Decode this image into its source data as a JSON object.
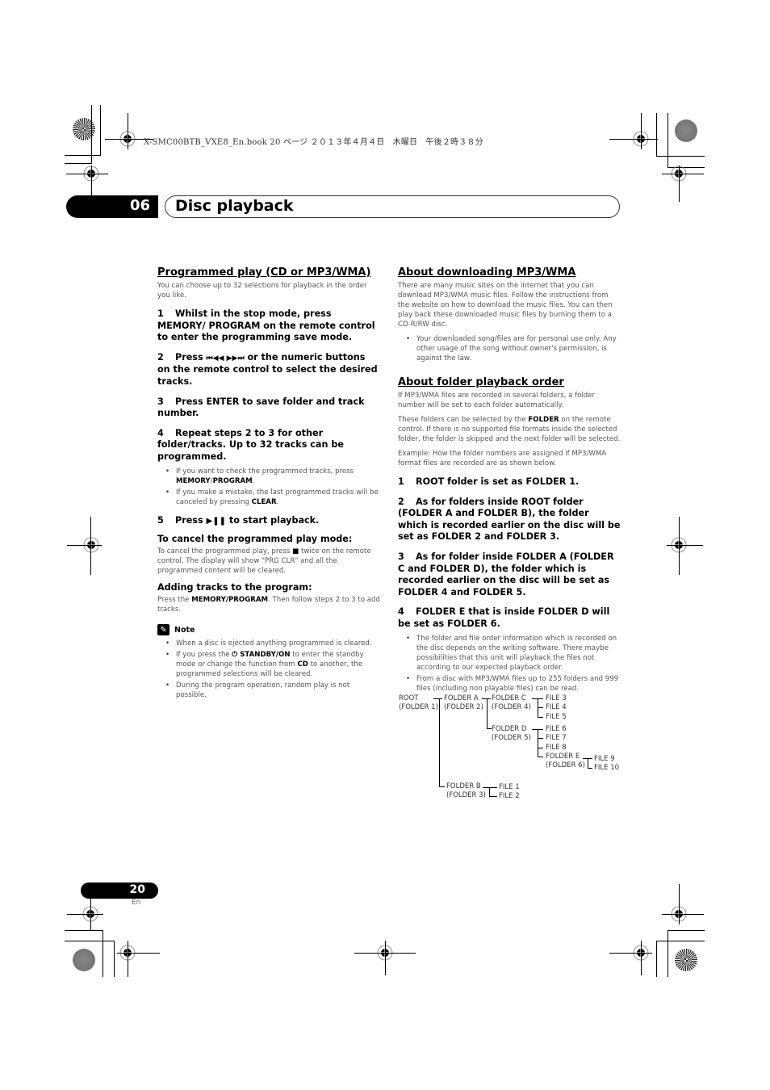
{
  "print_header": {
    "meta_text": "X-SMC00BTB_VXE8_En.book  20 ページ  ２０１３年４月４日　木曜日　午後２時３８分"
  },
  "chapter": {
    "number": "06",
    "title": "Disc playback"
  },
  "left_column": {
    "section_title": "Programmed play (CD or MP3/WMA)",
    "intro": "You can choose up to 32 selections for playback in the order you like.",
    "steps": [
      {
        "num": "1",
        "text": "Whilst in the stop mode, press MEMORY/ PROGRAM on the remote control to enter the programming save mode."
      },
      {
        "num": "2",
        "text_before": "Press ",
        "icons": "⏮◀◀ ▶▶⏭",
        "text_after": " or the numeric buttons on the remote control to select the desired tracks."
      },
      {
        "num": "3",
        "text": "Press ENTER to save folder and track number."
      },
      {
        "num": "4",
        "text": "Repeat steps 2 to 3 for other folder/tracks. Up to 32 tracks can be programmed."
      },
      {
        "num": "5",
        "text_before": "Press ",
        "icons": "▶❚❚",
        "text_after": " to start playback."
      }
    ],
    "step4_bullets": [
      {
        "before": "If you want to check the programmed tracks, press ",
        "bold": "MEMORY",
        "mid": "/",
        "bold2": "PROGRAM",
        "after": "."
      },
      {
        "before": "If you make a mistake, the last programmed tracks will be canceled by pressing ",
        "bold": "CLEAR",
        "after": "."
      }
    ],
    "cancel": {
      "title": "To cancel the programmed play mode:",
      "text_before": "To cancel the programmed play, press ",
      "stop_icon": "■",
      "text_after": " twice on the remote control. The display will show \"PRG CLR\" and all the programmed content will be cleared."
    },
    "adding": {
      "title": "Adding tracks to the program:",
      "text_before": "Press the ",
      "bold": "MEMORY/PROGRAM",
      "text_after": ". Then follow steps 2 to 3 to add tracks."
    },
    "note": {
      "label": "Note",
      "bullets": [
        {
          "text": "When a disc is ejected anything programmed is cleared."
        },
        {
          "before": "If you press the ",
          "icon": "⏻",
          "bold": " STANDBY/ON",
          "mid": " to enter the standby mode or change the function from ",
          "bold2": "CD",
          "after": " to another, the programmed selections will be cleared."
        },
        {
          "text": "During the program operation, random play is not possible."
        }
      ]
    }
  },
  "right_column": {
    "downloading": {
      "title": "About downloading MP3/WMA",
      "text": "There are many music sites on the internet that you can download MP3/WMA music files. Follow the instructions from the website on how to download the music files. You can then play back these downloaded music files by burning them to a CD-R/RW disc.",
      "bullet": "Your downloaded song/files are for personal use only. Any other usage of the song without owner's permission, is against the law."
    },
    "folder_order": {
      "title": "About folder playback order",
      "para1": "If MP3/WMA files are recorded in several folders, a folder number will be set to each folder automatically.",
      "para2_before": "These folders can be selected by the ",
      "para2_bold": "FOLDER",
      "para2_after": " on the remote control. If there is no supported file formats inside the selected folder, the folder is skipped and the next folder will be selected.",
      "para3": "Example: How the folder numbers are assigned if MP3/WMA format files are recorded are as shown below.",
      "steps": [
        {
          "num": "1",
          "text": "ROOT folder is set as FOLDER 1."
        },
        {
          "num": "2",
          "text": "As for folders inside ROOT folder (FOLDER A and FOLDER B), the folder which is recorded earlier on the disc will be set as FOLDER 2 and FOLDER 3."
        },
        {
          "num": "3",
          "text": "As for folder inside FOLDER A (FOLDER C and FOLDER D), the folder which is recorded earlier on the disc will be set as FOLDER 4 and FOLDER 5."
        },
        {
          "num": "4",
          "text": "FOLDER E that is inside FOLDER D will be set as FOLDER 6."
        }
      ],
      "bullets": [
        "The folder and file order information which is recorded on the disc depends on the writing software. There maybe possibilities that this unit will playback the files not according to our expected playback order.",
        "From a disc with MP3/WMA files up to 255 folders and 999 files (including non playable files) can be read."
      ]
    },
    "tree": {
      "root": [
        "ROOT",
        "(FOLDER 1)"
      ],
      "folder_a": [
        "FOLDER A",
        "(FOLDER 2)"
      ],
      "folder_b": [
        "FOLDER B",
        "(FOLDER 3)"
      ],
      "folder_c": [
        "FOLDER C",
        "(FOLDER 4)"
      ],
      "folder_d": [
        "FOLDER D",
        "(FOLDER 5)"
      ],
      "folder_e": [
        "FOLDER E",
        "(FOLDER 6)"
      ],
      "files": {
        "f1": "FILE 1",
        "f2": "FILE 2",
        "f3": "FILE 3",
        "f4": "FILE 4",
        "f5": "FILE 5",
        "f6": "FILE 6",
        "f7": "FILE 7",
        "f8": "FILE 8",
        "f9": "FILE 9",
        "f10": "FILE 10"
      }
    }
  },
  "footer": {
    "page_number": "20",
    "language": "En"
  }
}
